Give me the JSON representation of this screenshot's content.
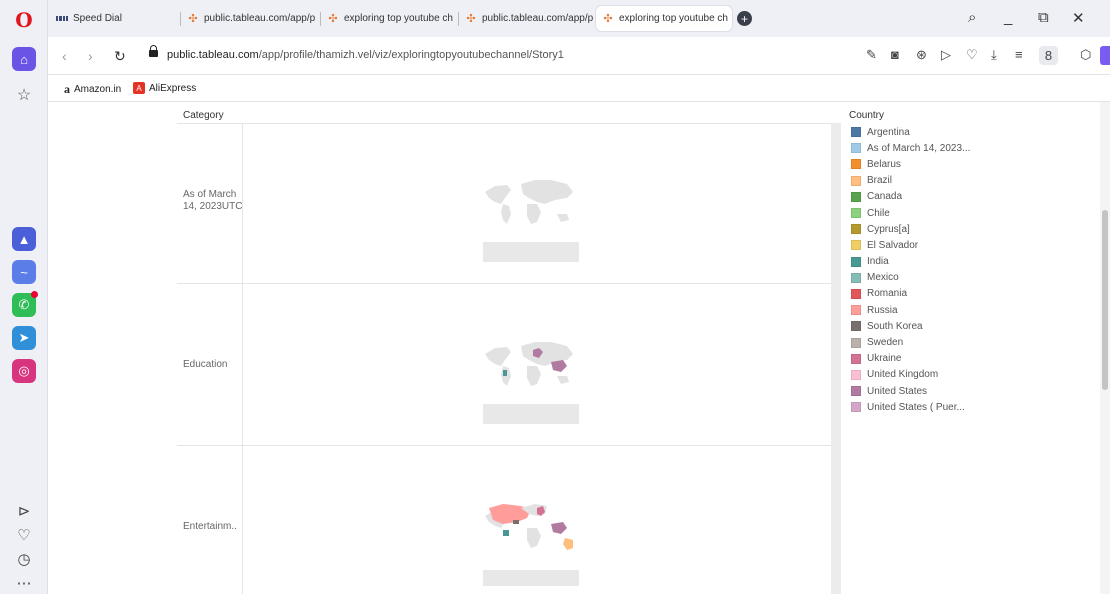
{
  "browser": {
    "tabs": [
      {
        "label": "Speed Dial"
      },
      {
        "label": "public.tableau.com/app/p"
      },
      {
        "label": "exploring top youtube ch"
      },
      {
        "label": "public.tableau.com/app/p"
      },
      {
        "label": "exploring top youtube ch"
      }
    ],
    "url_host": "public.tableau.com",
    "url_path": "/app/profile/thamizh.vel/viz/exploringtopyoutubechannel/Story1",
    "bookmarks": [
      {
        "label": "Amazon.in",
        "icon": "amazon-icon"
      },
      {
        "label": "AliExpress",
        "icon": "aliexpress-icon"
      }
    ],
    "amazon_glyph": "a",
    "ali_glyph": "A"
  },
  "viz": {
    "category_header": "Category",
    "rows": [
      {
        "label": "As of March 14, 2023UTC"
      },
      {
        "label": "Education"
      },
      {
        "label": "Entertainm.."
      }
    ],
    "legend_title": "Country",
    "legend": [
      {
        "label": "Argentina",
        "color": "#4e79a7"
      },
      {
        "label": "As of March 14, 2023...",
        "color": "#a0cbe8"
      },
      {
        "label": "Belarus",
        "color": "#f28e2b"
      },
      {
        "label": "Brazil",
        "color": "#ffbe7d"
      },
      {
        "label": "Canada",
        "color": "#59a14f"
      },
      {
        "label": "Chile",
        "color": "#8cd17d"
      },
      {
        "label": "Cyprus[a]",
        "color": "#b6992d"
      },
      {
        "label": "El Salvador",
        "color": "#f1ce63"
      },
      {
        "label": "India",
        "color": "#499894"
      },
      {
        "label": "Mexico",
        "color": "#86bcb6"
      },
      {
        "label": "Romania",
        "color": "#e15759"
      },
      {
        "label": "Russia",
        "color": "#ff9d9a"
      },
      {
        "label": "South Korea",
        "color": "#79706e"
      },
      {
        "label": "Sweden",
        "color": "#bab0ac"
      },
      {
        "label": "Ukraine",
        "color": "#d37295"
      },
      {
        "label": "United Kingdom",
        "color": "#fabfd2"
      },
      {
        "label": "United States",
        "color": "#b07aa1"
      },
      {
        "label": "United States ( Puer...",
        "color": "#d4a6c8"
      }
    ]
  }
}
